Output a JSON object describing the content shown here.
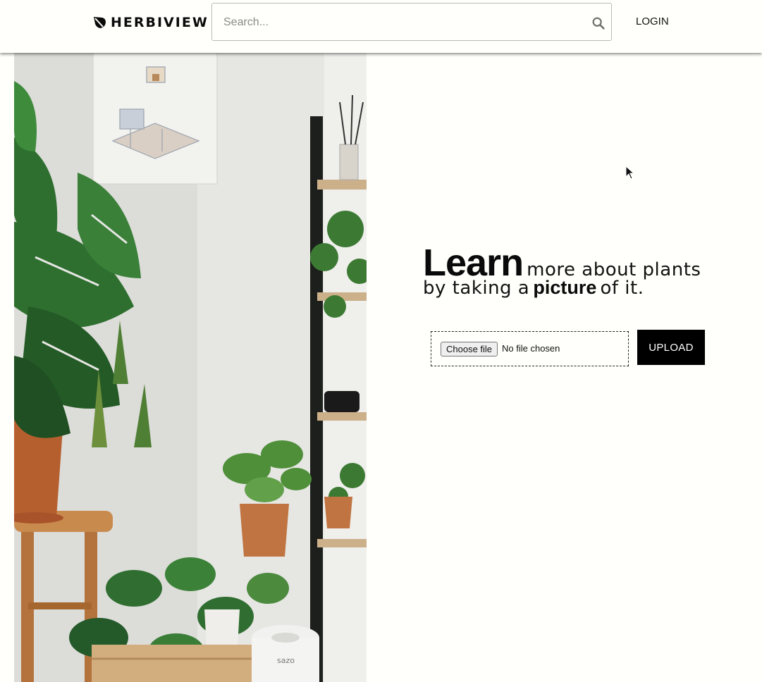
{
  "header": {
    "brand": "HERBIVIEW",
    "search_placeholder": "Search...",
    "login_label": "LOGIN",
    "logo_icon": "leaf-icon",
    "search_icon": "search-icon"
  },
  "hero": {
    "image_icon": "plant-photo"
  },
  "tagline": {
    "word1": "Learn",
    "text1": "more about plants",
    "text2": "by taking a",
    "word2": "picture",
    "text3": "of it."
  },
  "upload": {
    "choose_label": "Choose file",
    "file_status": "No file chosen",
    "upload_label": "UPLOAD"
  },
  "colors": {
    "background": "#fffffb",
    "accent": "#000000",
    "text": "#111111"
  }
}
